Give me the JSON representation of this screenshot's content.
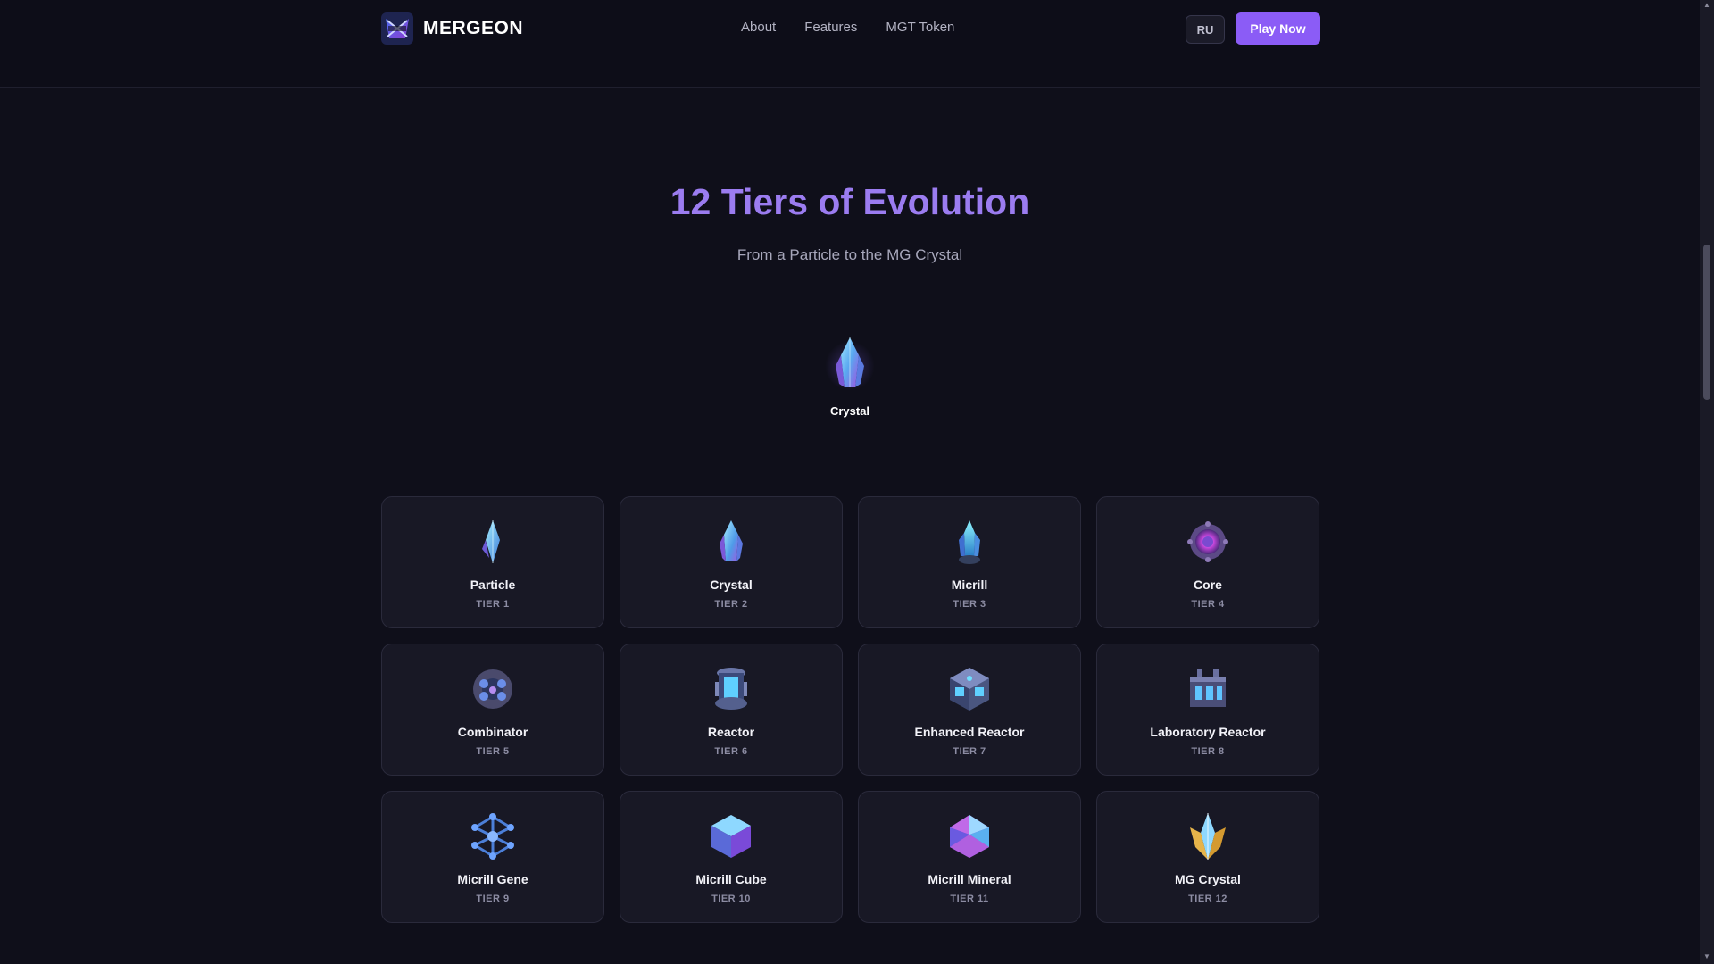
{
  "header": {
    "brand": "MERGEON",
    "nav": [
      {
        "label": "About"
      },
      {
        "label": "Features"
      },
      {
        "label": "MGT Token"
      }
    ],
    "lang_button": "RU",
    "play_button": "Play Now"
  },
  "section": {
    "title": "12 Tiers of Evolution",
    "subtitle": "From a Particle to the MG Crystal",
    "featured_label": "Crystal"
  },
  "tiers": [
    {
      "name": "Particle",
      "tier": "TIER 1",
      "icon": "particle-crystal-icon"
    },
    {
      "name": "Crystal",
      "tier": "TIER 2",
      "icon": "crystal-icon"
    },
    {
      "name": "Micrill",
      "tier": "TIER 3",
      "icon": "micrill-crystal-icon"
    },
    {
      "name": "Core",
      "tier": "TIER 4",
      "icon": "core-orb-icon"
    },
    {
      "name": "Combinator",
      "tier": "TIER 5",
      "icon": "combinator-sphere-icon"
    },
    {
      "name": "Reactor",
      "tier": "TIER 6",
      "icon": "reactor-cylinder-icon"
    },
    {
      "name": "Enhanced Reactor",
      "tier": "TIER 7",
      "icon": "enhanced-reactor-cube-icon"
    },
    {
      "name": "Laboratory Reactor",
      "tier": "TIER 8",
      "icon": "laboratory-reactor-icon"
    },
    {
      "name": "Micrill Gene",
      "tier": "TIER 9",
      "icon": "molecule-icon"
    },
    {
      "name": "Micrill Cube",
      "tier": "TIER 10",
      "icon": "cube-icon"
    },
    {
      "name": "Micrill Mineral",
      "tier": "TIER 11",
      "icon": "polyhedron-icon"
    },
    {
      "name": "MG Crystal",
      "tier": "TIER 12",
      "icon": "gold-crystal-icon"
    }
  ],
  "colors": {
    "background": "#0f0f1a",
    "accent": "#8b5cf6",
    "title": "#9b7cf0",
    "card": "#181825"
  }
}
